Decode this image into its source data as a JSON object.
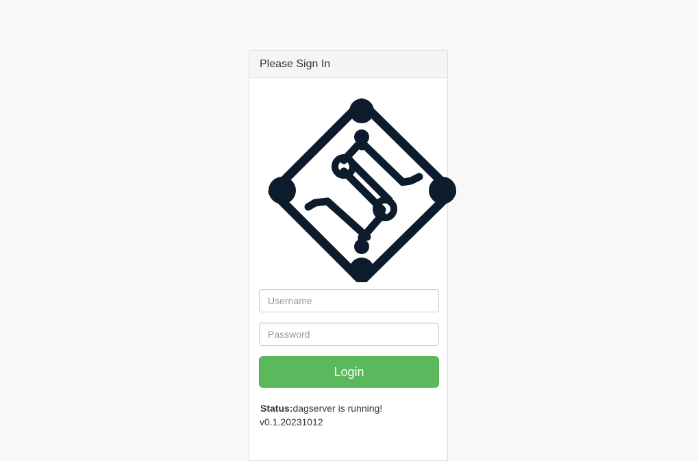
{
  "panel": {
    "heading": "Please Sign In"
  },
  "logo": {
    "icon": "dagserver-logo-icon",
    "color": "#0c1c2c"
  },
  "form": {
    "username_placeholder": "Username",
    "username_value": "",
    "password_placeholder": "Password",
    "password_value": "",
    "login_label": "Login"
  },
  "status": {
    "label": "Status:",
    "text": "dagserver is running!",
    "version": "v0.1.20231012"
  },
  "colors": {
    "background": "#f8f8f8",
    "login_button": "#5cb85c",
    "logo": "#0c1c2c"
  }
}
